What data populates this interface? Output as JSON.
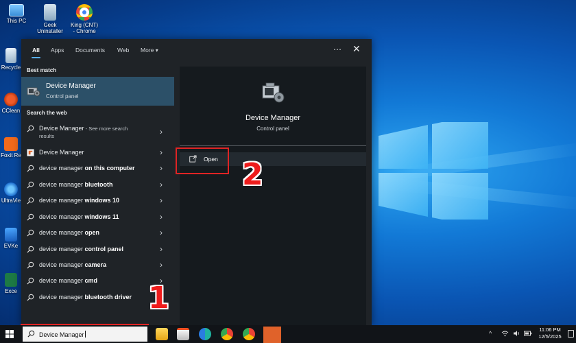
{
  "desktop": {
    "icons": [
      {
        "label": "This PC"
      },
      {
        "label": "Geek Uninstaller"
      },
      {
        "label": "King (CNT) - Chrome"
      },
      {
        "label": "Recycle"
      },
      {
        "label": "CClean"
      },
      {
        "label": "Foxit Re"
      },
      {
        "label": "UltraVie"
      },
      {
        "label": "EVKe"
      },
      {
        "label": "Exce"
      }
    ]
  },
  "search_panel": {
    "tabs": [
      "All",
      "Apps",
      "Documents",
      "Web",
      "More"
    ],
    "more_arrow": "▾",
    "options_icon": "⋯",
    "close_icon": "✕",
    "best_match_label": "Best match",
    "best_match": {
      "title": "Device Manager",
      "subtitle": "Control panel"
    },
    "search_web_label": "Search the web",
    "web_results": [
      {
        "prefix": "Device Manager",
        "bold": "",
        "extra": " - See more search",
        "extra2": "results",
        "icon": "search-icon"
      },
      {
        "prefix": "Device Manager",
        "bold": "",
        "extra": "",
        "icon": "web-app-icon"
      },
      {
        "prefix": "device manager ",
        "bold": "on this computer",
        "icon": "search-icon"
      },
      {
        "prefix": "device manager ",
        "bold": "bluetooth",
        "icon": "search-icon"
      },
      {
        "prefix": "device manager ",
        "bold": "windows 10",
        "icon": "search-icon"
      },
      {
        "prefix": "device manager ",
        "bold": "windows 11",
        "icon": "search-icon"
      },
      {
        "prefix": "device manager ",
        "bold": "open",
        "icon": "search-icon"
      },
      {
        "prefix": "device manager ",
        "bold": "control panel",
        "icon": "search-icon"
      },
      {
        "prefix": "device manager ",
        "bold": "camera",
        "icon": "search-icon"
      },
      {
        "prefix": "device manager ",
        "bold": "cmd",
        "icon": "search-icon"
      },
      {
        "prefix": "device manager ",
        "bold": "bluetooth driver",
        "icon": "search-icon"
      }
    ],
    "chevron": "›",
    "detail": {
      "title": "Device Manager",
      "subtitle": "Control panel",
      "open_label": "Open"
    }
  },
  "annotations": {
    "step1": "1",
    "step2": "2",
    "color": "#e02424"
  },
  "taskbar": {
    "search_value": "Device Manager",
    "tray": {
      "chevron": "^",
      "time": "11:06 PM",
      "date": "12/5/2025"
    }
  },
  "colors": {
    "accent": "#5ab0ff",
    "selected_bg": "#2c5068",
    "panel_bg": "#1f2327"
  }
}
